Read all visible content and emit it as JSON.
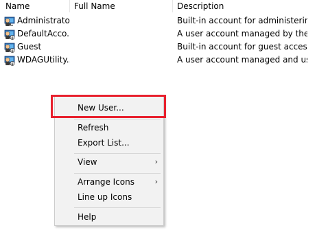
{
  "columns": {
    "name": "Name",
    "full_name": "Full Name",
    "description": "Description"
  },
  "users": [
    {
      "name": "Administrator",
      "full_name": "",
      "description": "Built-in account for administering...",
      "icon": "user-icon"
    },
    {
      "name": "DefaultAcco...",
      "full_name": "",
      "description": "A user account managed by the s...",
      "icon": "user-icon"
    },
    {
      "name": "Guest",
      "full_name": "",
      "description": "Built-in account for guest access t...",
      "icon": "user-icon"
    },
    {
      "name": "WDAGUtility...",
      "full_name": "",
      "description": "A user account managed and use...",
      "icon": "user-icon"
    }
  ],
  "context_menu": {
    "new_user": "New User...",
    "refresh": "Refresh",
    "export_list": "Export List...",
    "view": "View",
    "arrange_icons": "Arrange Icons",
    "line_up_icons": "Line up Icons",
    "help": "Help",
    "submenu_arrow": "›"
  },
  "colors": {
    "highlight_border": "#e8212e",
    "menu_background": "#f2f2f2"
  }
}
